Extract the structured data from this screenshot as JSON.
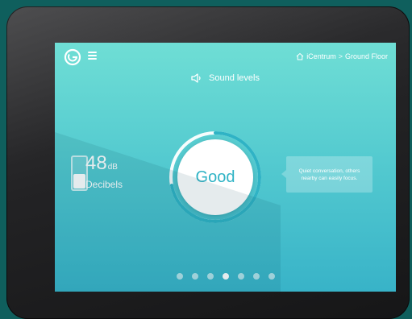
{
  "header": {
    "breadcrumb": [
      "iCentrum",
      "Ground Floor"
    ],
    "breadcrumb_separator": ">",
    "home_icon": "house-icon",
    "menu_icon": "hamburger-icon",
    "logo_icon": "g-logo-icon"
  },
  "title": {
    "icon": "speaker-icon",
    "label": "Sound levels"
  },
  "reading": {
    "value": "48",
    "unit": "dB",
    "label": "Decibels",
    "level_fraction": 0.5
  },
  "gauge": {
    "status": "Good",
    "arc_fraction": 0.72
  },
  "info": {
    "text": "Quiet conversation, others nearby can easily focus."
  },
  "pagination": {
    "count": 7,
    "active_index": 3
  },
  "colors": {
    "accent": "#2fb3c5",
    "screen_top": "#6fded5",
    "screen_bottom": "#38b3c8"
  }
}
